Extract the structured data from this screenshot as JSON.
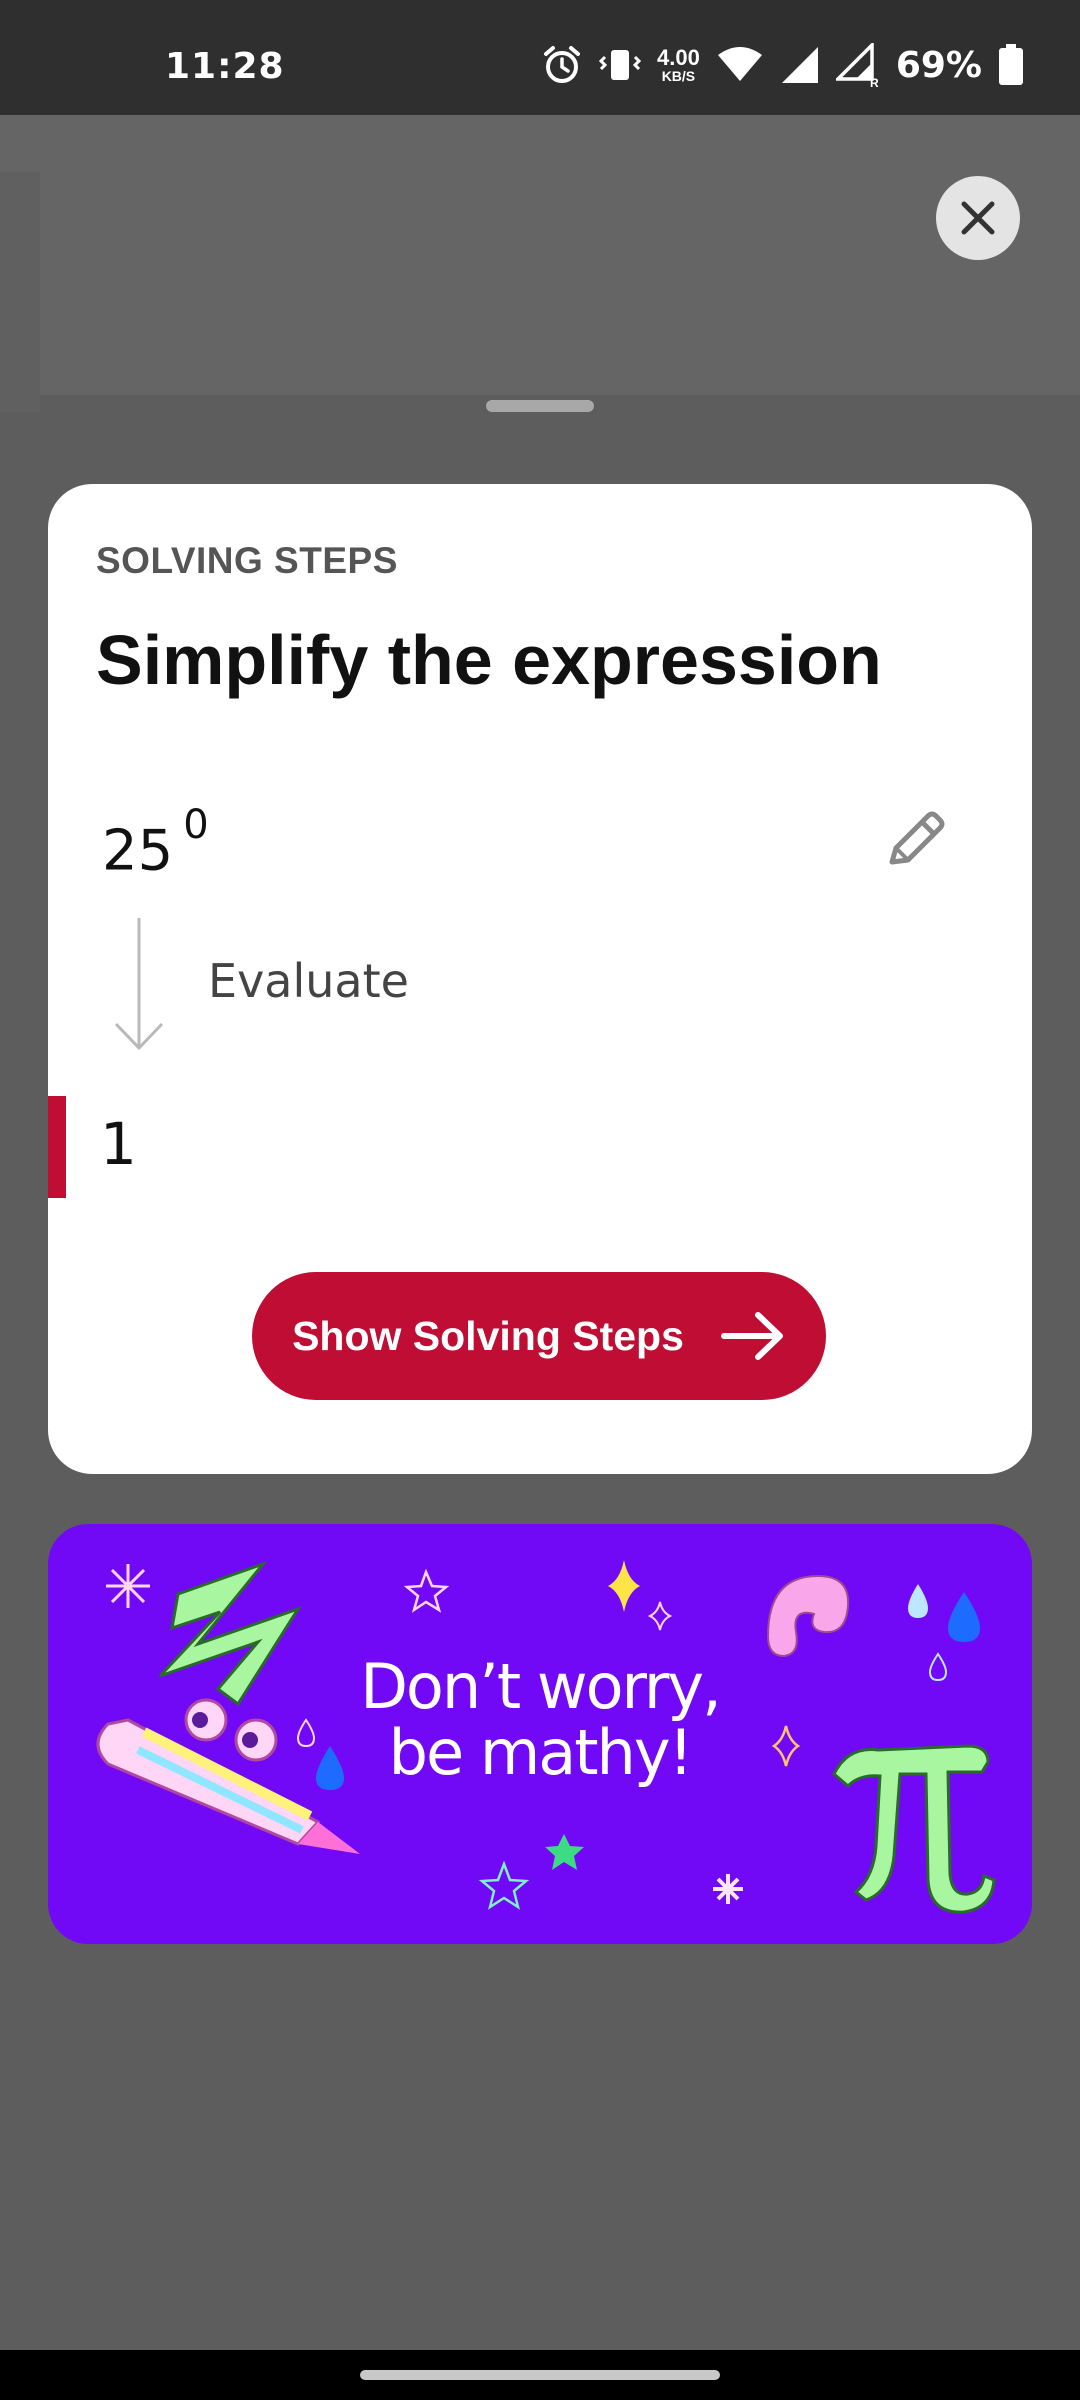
{
  "status_bar": {
    "time": "11:28",
    "net_speed_value": "4.00",
    "net_speed_unit": "KB/S",
    "battery_percent": "69%",
    "icons": [
      "alarm-icon",
      "vibrate-icon",
      "wifi-icon",
      "signal-icon",
      "signal-roaming-icon",
      "battery-icon"
    ]
  },
  "sheet": {
    "eyebrow": "SOLVING STEPS",
    "title": "Simplify the expression",
    "expression_base": "25",
    "expression_exponent": "0",
    "step_label": "Evaluate",
    "result": "1",
    "button_label": "Show Solving Steps",
    "accent_color": "#bf0d33"
  },
  "banner": {
    "line1": "Don’t worry,",
    "line2": "be mathy!",
    "background": "#7209f6"
  }
}
